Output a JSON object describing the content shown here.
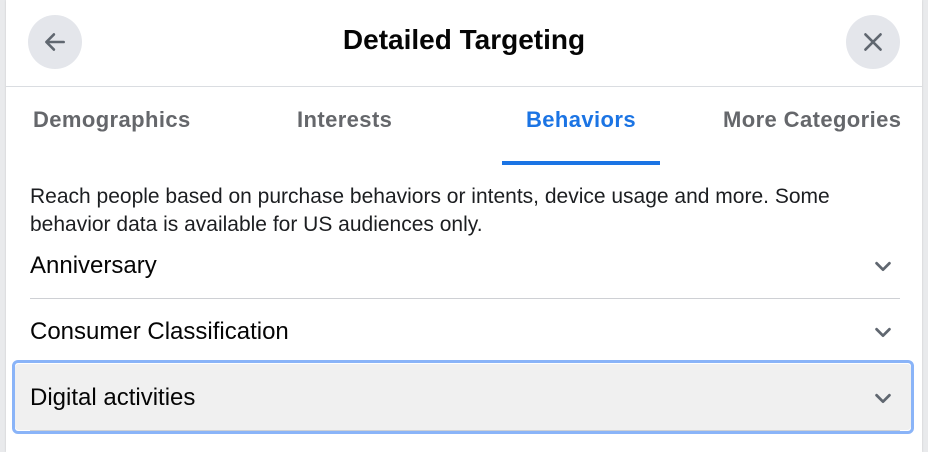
{
  "dialog": {
    "title": "Detailed Targeting",
    "back_icon": "arrow-left-icon",
    "close_icon": "close-icon"
  },
  "tabs": [
    {
      "label": "Demographics",
      "active": false
    },
    {
      "label": "Interests",
      "active": false
    },
    {
      "label": "Behaviors",
      "active": true
    },
    {
      "label": "More Categories",
      "active": false
    }
  ],
  "description": "Reach people based on purchase behaviors or intents, device usage and more. Some behavior data is available for US audiences only.",
  "categories": [
    {
      "label": "Anniversary",
      "icon": "chevron-down-icon"
    },
    {
      "label": "Consumer Classification",
      "icon": "chevron-down-icon"
    },
    {
      "label": "Digital activities",
      "icon": "chevron-down-icon",
      "focused": true
    }
  ],
  "colors": {
    "accent": "#1b74e4",
    "focus_ring": "#8ab4f8",
    "button_bg": "#e4e6eb",
    "muted_text": "#65676b"
  }
}
